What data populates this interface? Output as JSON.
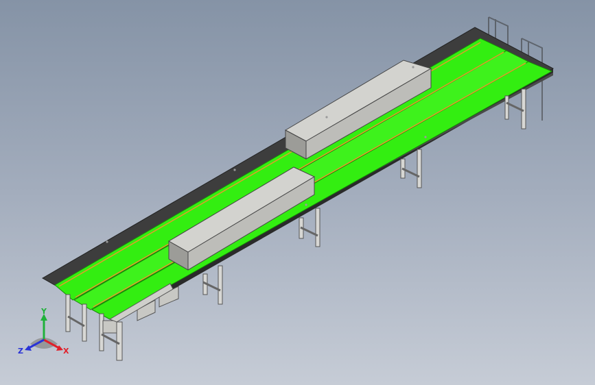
{
  "viewport": {
    "background_top": "#8593a6",
    "background_bottom": "#c6ccd6"
  },
  "model": {
    "belt_color": "#33ee11",
    "frame_color": "#3d3d3d",
    "cover_color": "#c8c8c4",
    "leg_color": "#d2d2d2",
    "rail_accent": "#e39b2c"
  },
  "triad": {
    "x_label": "X",
    "y_label": "Y",
    "z_label": "Z",
    "x_color": "#e0202a",
    "y_color": "#1fb13a",
    "z_color": "#2a34d6"
  }
}
